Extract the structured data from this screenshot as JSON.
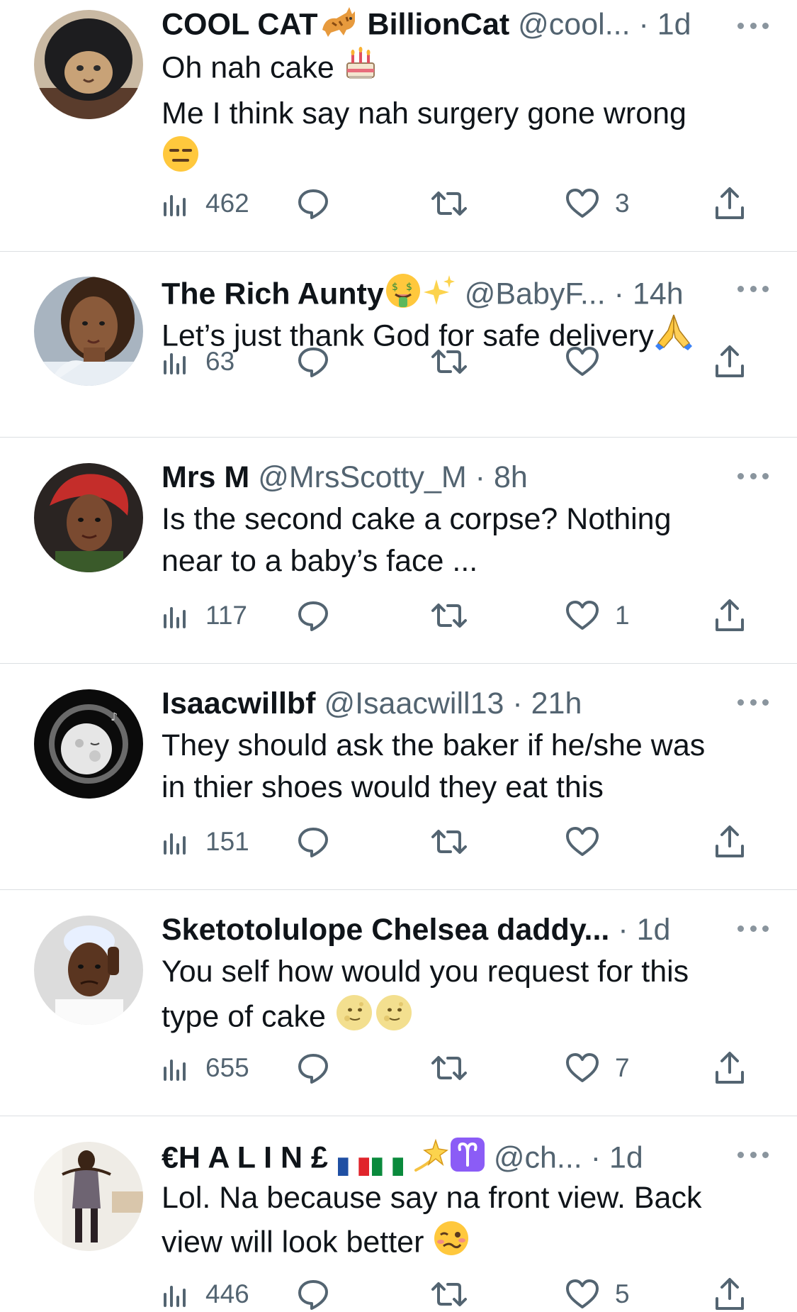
{
  "replies": [
    {
      "display_name": "COOL CAT",
      "display_name_suffix": "BillionCat",
      "handle": "@cool...",
      "time": "1d",
      "lines": [
        "Oh nah cake",
        "Me I think say nah surgery gone wrong"
      ],
      "views": "462",
      "likes": "3"
    },
    {
      "display_name": "The Rich Aunty",
      "handle": "@BabyF...",
      "time": "14h",
      "lines": [
        "Let’s just thank God for safe delivery"
      ],
      "views": "63",
      "likes": ""
    },
    {
      "display_name": "Mrs M",
      "handle": "@MrsScotty_M",
      "time": "8h",
      "lines": [
        "Is the second cake a corpse? Nothing",
        "near to a baby’s face ..."
      ],
      "views": "117",
      "likes": "1"
    },
    {
      "display_name": "Isaacwillbf",
      "handle": "@Isaacwill13",
      "time": "21h",
      "lines": [
        "They should ask the baker if he/she was",
        "in thier shoes would they eat this"
      ],
      "views": "151",
      "likes": ""
    },
    {
      "display_name": "Sketotolulope Chelsea daddy...",
      "handle": "",
      "time": "1d",
      "lines": [
        "You self how would you request for this",
        "type of cake"
      ],
      "views": "655",
      "likes": "7"
    },
    {
      "display_name": "€H A L I N £",
      "handle": "@ch...",
      "time": "1d",
      "lines": [
        "Lol. Na because say na front view. Back",
        "view will look better"
      ],
      "views": "446",
      "likes": "5"
    }
  ],
  "separator": "·",
  "icons": [
    "views-icon",
    "reply-icon",
    "retweet-icon",
    "like-icon",
    "share-icon",
    "more-icon"
  ],
  "colors": {
    "text": "#0f1419",
    "muted": "#536471",
    "divider": "#dcdfe2"
  }
}
